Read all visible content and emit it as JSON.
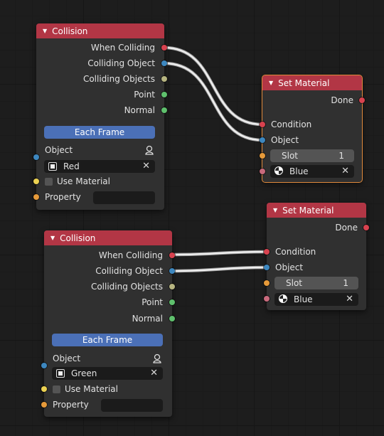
{
  "nodes": {
    "collision_top": {
      "title": "Collision",
      "outputs": [
        "When Colliding",
        "Colliding Object",
        "Colliding Objects",
        "Point",
        "Normal"
      ],
      "mode_button": "Each Frame",
      "object_label": "Object",
      "object_value": "Red",
      "use_material_label": "Use Material",
      "property_label": "Property",
      "property_value": ""
    },
    "set_material_top": {
      "title": "Set Material",
      "output": "Done",
      "inputs": [
        "Condition",
        "Object"
      ],
      "slot_label": "Slot",
      "slot_value": "1",
      "material_value": "Blue"
    },
    "set_material_bottom": {
      "title": "Set Material",
      "output": "Done",
      "inputs": [
        "Condition",
        "Object"
      ],
      "slot_label": "Slot",
      "slot_value": "1",
      "material_value": "Blue"
    },
    "collision_bottom": {
      "title": "Collision",
      "outputs": [
        "When Colliding",
        "Colliding Object",
        "Colliding Objects",
        "Point",
        "Normal"
      ],
      "mode_button": "Each Frame",
      "object_label": "Object",
      "object_value": "Green",
      "use_material_label": "Use Material",
      "property_label": "Property",
      "property_value": ""
    }
  },
  "icons": {
    "collapse": "triangle-down-icon",
    "object": "object-square-icon",
    "material": "material-sphere-icon",
    "clear": "x-icon",
    "eyedropper": "eyedropper-icon"
  },
  "colors": {
    "header": "#b23645",
    "node_body": "#303030",
    "button": "#4b70b7",
    "socket_trigger": "#d8424f",
    "socket_object": "#3d87bf",
    "socket_list": "#b7b581",
    "socket_vector": "#5fc06d",
    "socket_bool": "#ecd252",
    "socket_string": "#e69a3a",
    "socket_material": "#c96a7d",
    "selection": "#e08a3c"
  },
  "glyphs": {
    "collapse": "▼",
    "clear": "✕"
  }
}
